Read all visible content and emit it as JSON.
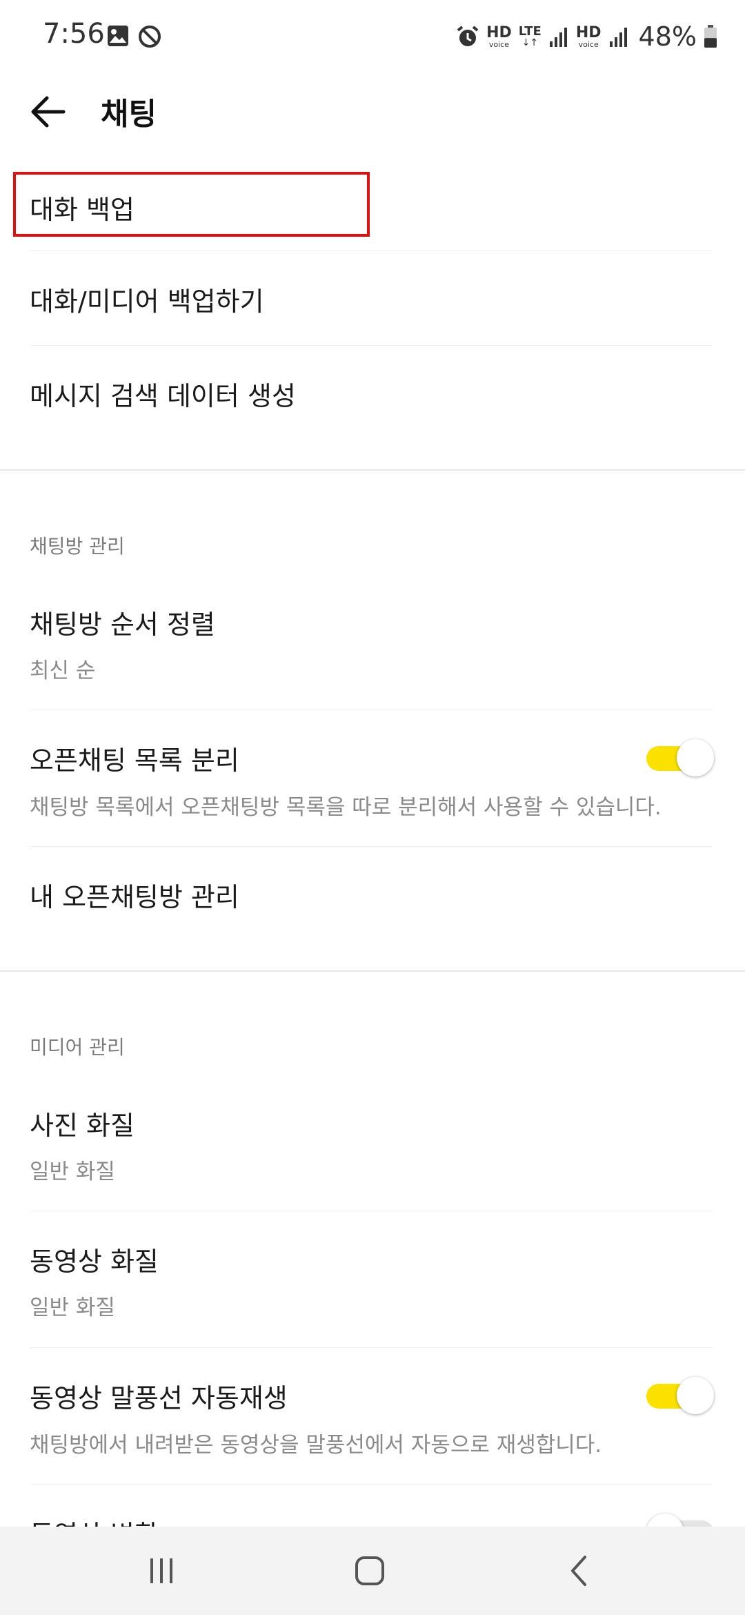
{
  "status_bar": {
    "time": "7:56",
    "hd_label": "HD",
    "voice_label": "voice",
    "lte_label": "LTE",
    "lte_arrows": "↓↑",
    "battery_pct": "48%",
    "battery_level": 0.48,
    "icons": [
      "image-icon",
      "do-not-disturb-icon",
      "alarm-icon",
      "signal-icon",
      "battery-icon"
    ]
  },
  "app_bar": {
    "title": "채팅",
    "back_icon": "arrow-left-icon"
  },
  "backup_section": {
    "items": [
      {
        "title": "대화 백업"
      },
      {
        "title": "대화/미디어 백업하기"
      },
      {
        "title": "메시지 검색 데이터 생성"
      }
    ]
  },
  "chatroom_section": {
    "header": "채팅방 관리",
    "sort": {
      "title": "채팅방 순서 정렬",
      "value": "최신 순"
    },
    "open_chat_split": {
      "title": "오픈채팅 목록 분리",
      "description": "채팅방 목록에서 오픈채팅방 목록을 따로 분리해서 사용할 수 있습니다.",
      "enabled": true
    },
    "my_open_chat": {
      "title": "내 오픈채팅방 관리"
    }
  },
  "media_section": {
    "header": "미디어 관리",
    "photo_quality": {
      "title": "사진 화질",
      "value": "일반 화질"
    },
    "video_quality": {
      "title": "동영상 화질",
      "value": "일반 화질"
    },
    "video_autoplay": {
      "title": "동영상 말풍선 자동재생",
      "description": "채팅방에서 내려받은 동영상을 말풍선에서 자동으로 재생합니다.",
      "enabled": true
    },
    "partial_item": {
      "title": "동영상 변환",
      "enabled": false
    }
  },
  "colors": {
    "toggle_on": "#fae100",
    "toggle_off": "#e4e4e4",
    "highlight": "#e01010"
  },
  "nav_bar": {
    "icons": [
      "recent-apps-icon",
      "home-icon",
      "back-icon"
    ]
  }
}
